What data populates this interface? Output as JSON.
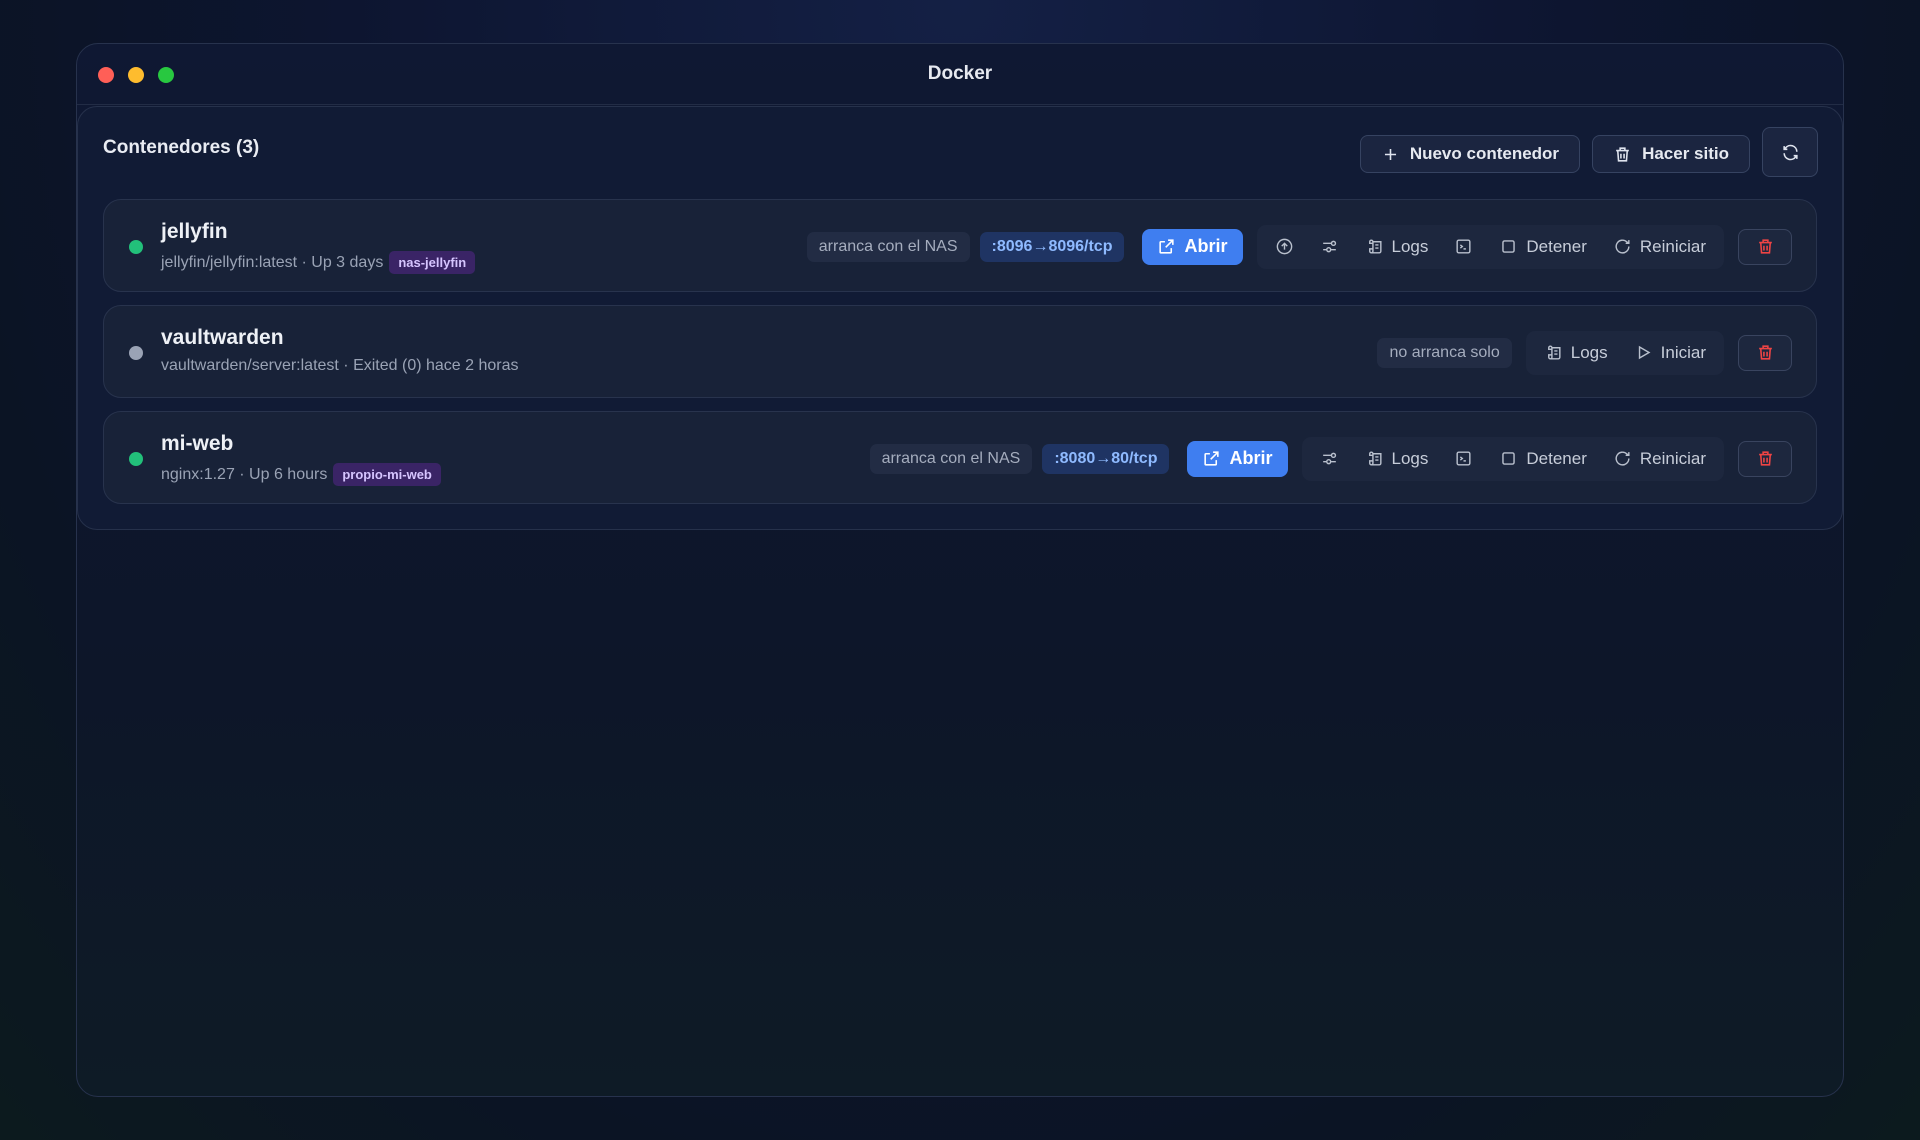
{
  "window": {
    "title": "Docker"
  },
  "panel": {
    "title": "Contenedores (3)"
  },
  "toolbar": {
    "new_label": "Nuevo contenedor",
    "prune_label": "Hacer sitio"
  },
  "containers": [
    {
      "name": "jellyfin",
      "meta": "jellyfin/jellyfin:latest · Up 3 days",
      "tag": "nas-jellyfin",
      "restart": "arranca con el NAS",
      "port": ":8096→8096/tcp",
      "open": "Abrir",
      "logs": "Logs",
      "stop": "Detener",
      "restart_btn": "Reiniciar"
    },
    {
      "name": "vaultwarden",
      "meta": "vaultwarden/server:latest · Exited (0) hace 2 horas",
      "restart": "no arranca solo",
      "logs": "Logs",
      "start": "Iniciar"
    },
    {
      "name": "mi-web",
      "meta": "nginx:1.27 · Up 6 hours",
      "tag": "propio-mi-web",
      "restart": "arranca con el NAS",
      "port": ":8080→80/tcp",
      "open": "Abrir",
      "logs": "Logs",
      "stop": "Detener",
      "restart_btn": "Reiniciar"
    }
  ],
  "colors": {
    "accent": "#3f7ef0",
    "running": "#22c07a",
    "stopped": "#9aa3b5",
    "danger": "#ef4444",
    "tag_bg": "#3a2466"
  }
}
